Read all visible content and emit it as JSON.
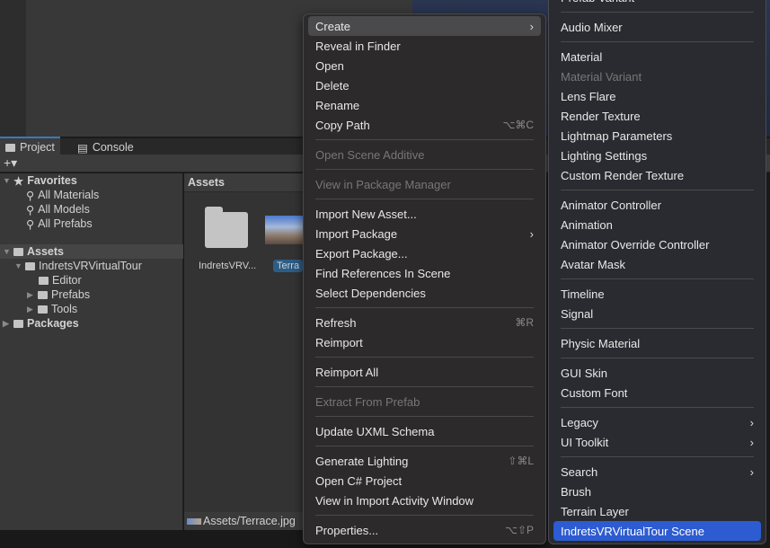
{
  "project": {
    "tabs": [
      "Project",
      "Console"
    ],
    "add_label": "+▾",
    "favorites": {
      "label": "Favorites",
      "items": [
        "All Materials",
        "All Models",
        "All Prefabs"
      ]
    },
    "assets_root": "Assets",
    "tour": "IndretsVRVirtualTour",
    "tour_children": [
      "Editor",
      "Prefabs",
      "Tools"
    ],
    "packages": "Packages",
    "grid_header": "Assets",
    "grid_items": [
      "IndretsVRV...",
      "Terra"
    ],
    "status_path": "Assets/Terrace.jpg"
  },
  "menu": [
    {
      "label": "Create",
      "arrow": true,
      "state": "highlighted"
    },
    {
      "label": "Reveal in Finder"
    },
    {
      "label": "Open"
    },
    {
      "label": "Delete"
    },
    {
      "label": "Rename"
    },
    {
      "label": "Copy Path",
      "shortcut": "⌥⌘C"
    },
    "sep",
    {
      "label": "Open Scene Additive",
      "disabled": true
    },
    "sep",
    {
      "label": "View in Package Manager",
      "disabled": true
    },
    "sep",
    {
      "label": "Import New Asset..."
    },
    {
      "label": "Import Package",
      "arrow": true
    },
    {
      "label": "Export Package..."
    },
    {
      "label": "Find References In Scene"
    },
    {
      "label": "Select Dependencies"
    },
    "sep",
    {
      "label": "Refresh",
      "shortcut": "⌘R"
    },
    {
      "label": "Reimport"
    },
    "sep",
    {
      "label": "Reimport All"
    },
    "sep",
    {
      "label": "Extract From Prefab",
      "disabled": true
    },
    "sep",
    {
      "label": "Update UXML Schema"
    },
    "sep",
    {
      "label": "Generate Lighting",
      "shortcut": "⇧⌘L"
    },
    {
      "label": "Open C# Project"
    },
    {
      "label": "View in Import Activity Window"
    },
    "sep",
    {
      "label": "Properties...",
      "shortcut": "⌥⇧P"
    }
  ],
  "submenu": [
    {
      "label": "Prefab Variant"
    },
    "sep",
    {
      "label": "Audio Mixer"
    },
    "sep",
    {
      "label": "Material"
    },
    {
      "label": "Material Variant",
      "disabled": true
    },
    {
      "label": "Lens Flare"
    },
    {
      "label": "Render Texture"
    },
    {
      "label": "Lightmap Parameters"
    },
    {
      "label": "Lighting Settings"
    },
    {
      "label": "Custom Render Texture"
    },
    "sep",
    {
      "label": "Animator Controller"
    },
    {
      "label": "Animation"
    },
    {
      "label": "Animator Override Controller"
    },
    {
      "label": "Avatar Mask"
    },
    "sep",
    {
      "label": "Timeline"
    },
    {
      "label": "Signal"
    },
    "sep",
    {
      "label": "Physic Material"
    },
    "sep",
    {
      "label": "GUI Skin"
    },
    {
      "label": "Custom Font"
    },
    "sep",
    {
      "label": "Legacy",
      "arrow": true
    },
    {
      "label": "UI Toolkit",
      "arrow": true
    },
    "sep",
    {
      "label": "Search",
      "arrow": true
    },
    {
      "label": "Brush"
    },
    {
      "label": "Terrain Layer"
    },
    {
      "label": "IndretsVRVirtualTour Scene",
      "state": "selected"
    }
  ]
}
